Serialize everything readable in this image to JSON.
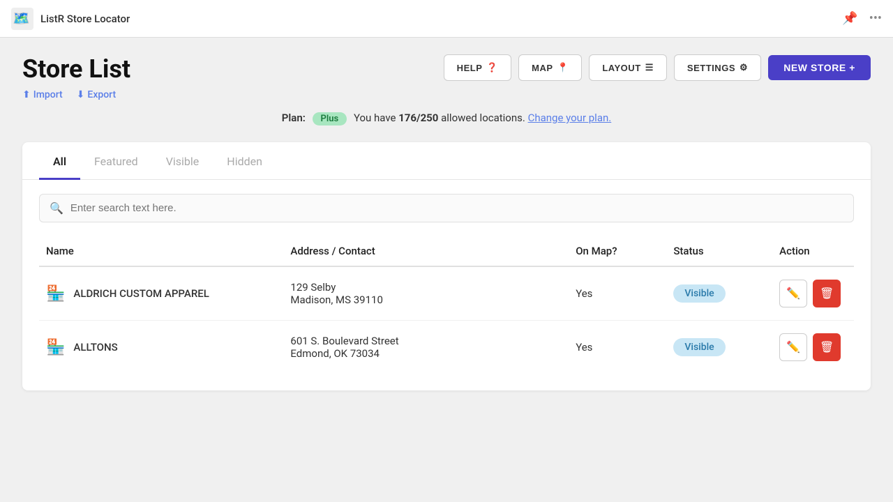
{
  "topbar": {
    "app_name": "ListR Store Locator"
  },
  "header": {
    "title": "Store List",
    "import_label": "Import",
    "export_label": "Export"
  },
  "toolbar": {
    "help_label": "HELP",
    "map_label": "MAP",
    "layout_label": "LAYOUT",
    "settings_label": "SETTINGS",
    "new_store_label": "NEW STORE +"
  },
  "plan": {
    "label": "Plan:",
    "badge": "Plus",
    "description_prefix": "You have ",
    "count": "176/250",
    "description_suffix": " allowed locations.",
    "link": "Change your plan."
  },
  "tabs": [
    {
      "label": "All",
      "active": true
    },
    {
      "label": "Featured",
      "active": false
    },
    {
      "label": "Visible",
      "active": false
    },
    {
      "label": "Hidden",
      "active": false
    }
  ],
  "search": {
    "placeholder": "Enter search text here."
  },
  "table": {
    "columns": [
      {
        "label": "Name"
      },
      {
        "label": "Address / Contact"
      },
      {
        "label": "On Map?"
      },
      {
        "label": "Status"
      },
      {
        "label": "Action"
      }
    ],
    "rows": [
      {
        "name": "ALDRICH CUSTOM APPAREL",
        "address_line1": "129 Selby",
        "address_line2": "Madison, MS 39110",
        "on_map": "Yes",
        "status": "Visible"
      },
      {
        "name": "ALLTONS",
        "address_line1": "601 S. Boulevard Street",
        "address_line2": "Edmond, OK 73034",
        "on_map": "Yes",
        "status": "Visible"
      }
    ]
  }
}
